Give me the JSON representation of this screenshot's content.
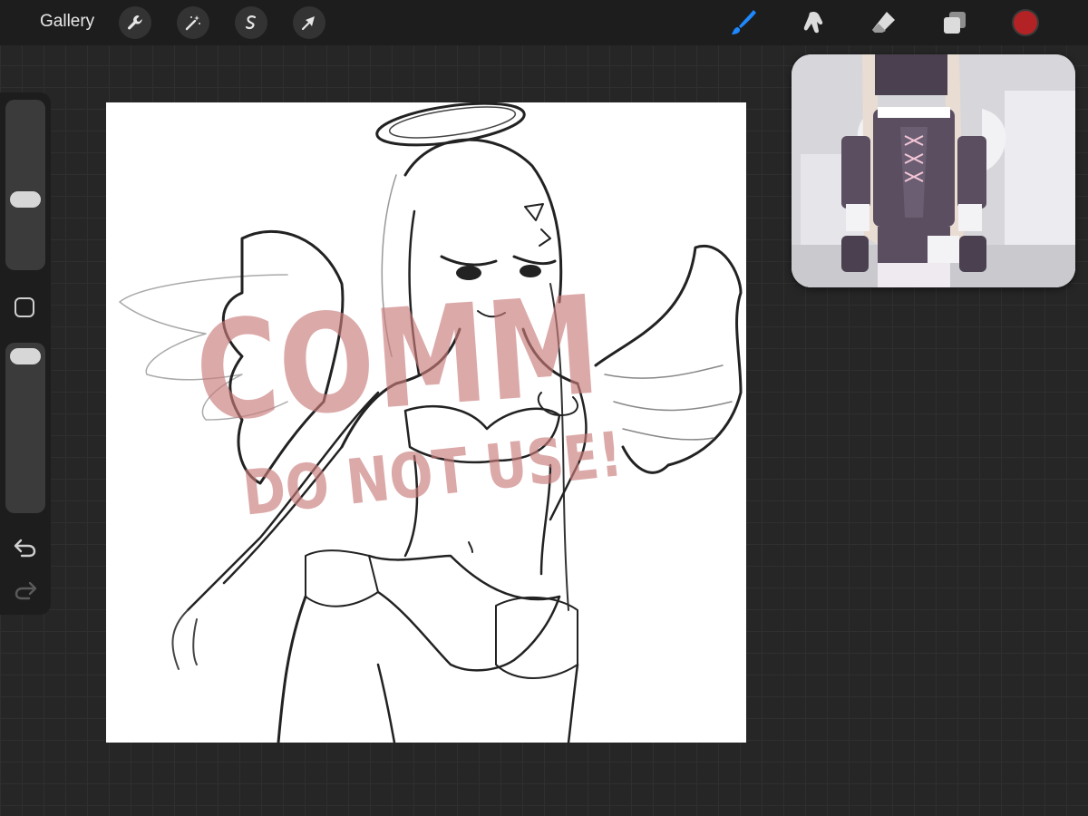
{
  "toolbar": {
    "gallery_label": "Gallery",
    "left_tools": [
      "wrench-icon",
      "magic-wand-icon",
      "selection-icon",
      "transform-arrow-icon"
    ],
    "right_tools": [
      "brush-icon",
      "smudge-icon",
      "eraser-icon",
      "layers-icon"
    ],
    "active_tool": "brush-icon",
    "accent_color": "#1e88ff",
    "current_color": "#b32224"
  },
  "sidebar": {
    "brush_size_level": 0.55,
    "opacity_level": 0.95,
    "icons": [
      "modify-square-icon",
      "undo-icon",
      "redo-icon"
    ]
  },
  "canvas": {
    "watermark_line1": "COMM",
    "watermark_line2": "DO NOT USE!",
    "watermark_color": "#c97b7b"
  },
  "reference": {
    "description_icon": "reference-image"
  }
}
